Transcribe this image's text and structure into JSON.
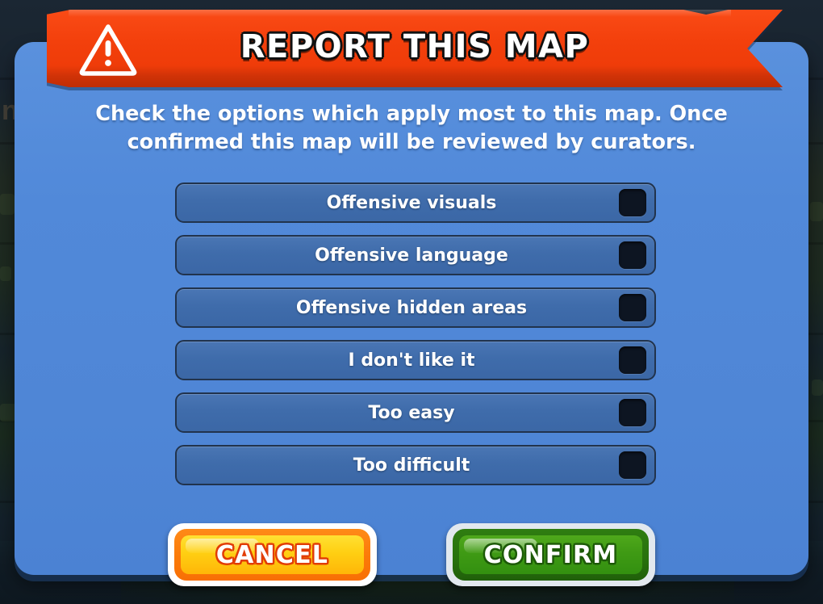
{
  "dialog": {
    "title": "REPORT THIS MAP",
    "warning_icon": "warning-triangle-icon",
    "instructions": "Check the options which apply most to this map. Once confirmed this map will be reviewed by curators.",
    "accent_ribbon_color": "#ef3c09",
    "panel_color": "#4f88d8",
    "option_row_color": "#3f6cab",
    "checkbox_color": "#0d1522"
  },
  "options": [
    {
      "label": "Offensive visuals",
      "checked": false
    },
    {
      "label": "Offensive language",
      "checked": false
    },
    {
      "label": "Offensive hidden areas",
      "checked": false
    },
    {
      "label": "I don't like it",
      "checked": false
    },
    {
      "label": "Too easy",
      "checked": false
    },
    {
      "label": "Too difficult",
      "checked": false
    }
  ],
  "actions": {
    "cancel_label": "CANCEL",
    "cancel_color": "#ffcf12",
    "confirm_label": "CONFIRM",
    "confirm_color": "#3f9a14"
  },
  "background": {
    "partial_text": "n"
  }
}
